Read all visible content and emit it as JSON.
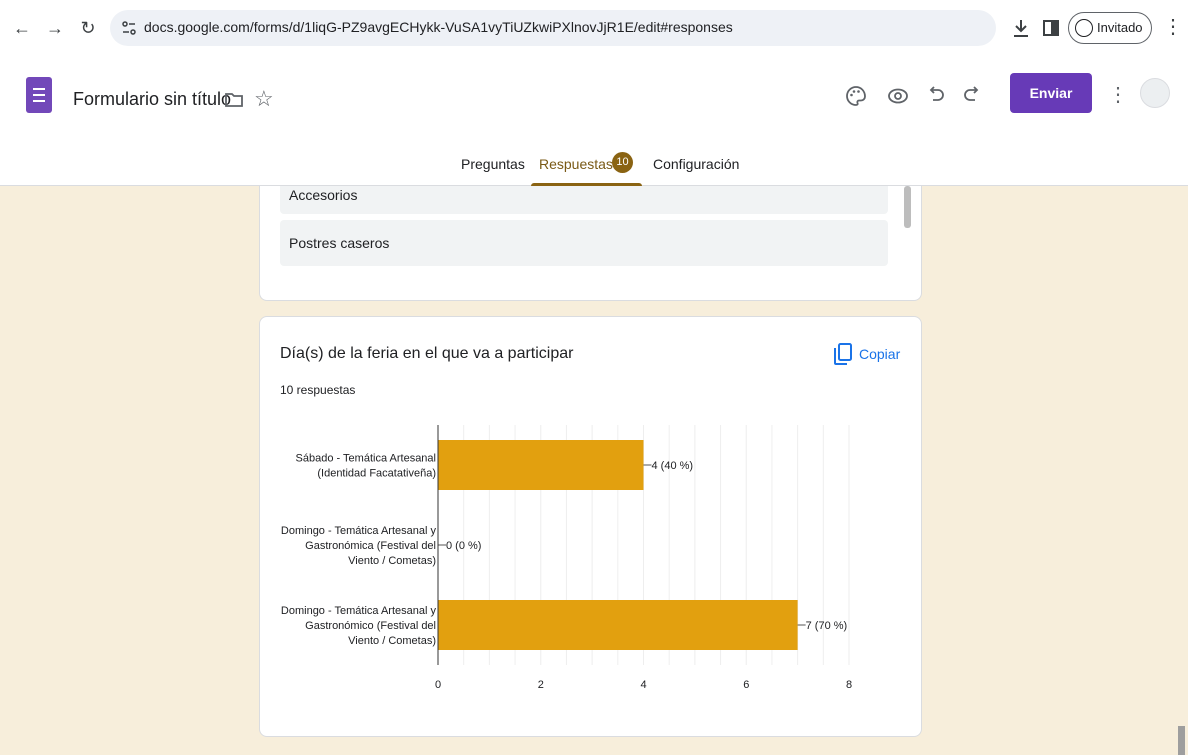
{
  "browser": {
    "url": "docs.google.com/forms/d/1liqG-PZ9avgECHykk-VuSA1vyTiUZkwiPXlnovJjR1E/edit#responses",
    "profile_label": "Invitado",
    "icons": [
      "back-arrow-icon",
      "forward-arrow-icon",
      "reload-icon",
      "site-settings-icon",
      "download-icon",
      "side-panel-icon",
      "profile-icon",
      "more-vert-icon"
    ]
  },
  "header": {
    "title": "Formulario sin título",
    "send_label": "Enviar",
    "icons": [
      "forms-logo-icon",
      "folder-icon",
      "star-icon",
      "palette-icon",
      "preview-eye-icon",
      "undo-icon",
      "redo-icon",
      "more-vert-icon",
      "account-avatar"
    ],
    "accent_color": "#673ab7"
  },
  "tabs": [
    {
      "label": "Preguntas",
      "active": false
    },
    {
      "label": "Respuestas",
      "active": true,
      "badge": "10"
    },
    {
      "label": "Configuración",
      "active": false
    }
  ],
  "prev_card": {
    "options": [
      "Accesorios",
      "Postres caseros"
    ]
  },
  "question_card": {
    "title": "Día(s) de la feria en el que va a participar",
    "response_count": "10 respuestas",
    "copy_label": "Copiar"
  },
  "chart_data": {
    "type": "bar",
    "orientation": "horizontal",
    "categories": [
      [
        "Sábado - Temática Artesanal",
        "(Identidad Facatativeña)"
      ],
      [
        "Domingo - Temática Artesanal y",
        "Gastronómica (Festival del",
        "Viento / Cometas)"
      ],
      [
        "Domingo - Temática Artesanal y",
        "Gastronómico (Festival del",
        "Viento / Cometas)"
      ]
    ],
    "values": [
      4,
      0,
      7
    ],
    "value_labels": [
      "4 (40 %)",
      "0 (0 %)",
      "7 (70 %)"
    ],
    "x_ticks": [
      "0",
      "2",
      "4",
      "6",
      "8"
    ],
    "xlim": [
      0,
      8
    ],
    "grid": true,
    "bar_color": "#e2a00f"
  }
}
